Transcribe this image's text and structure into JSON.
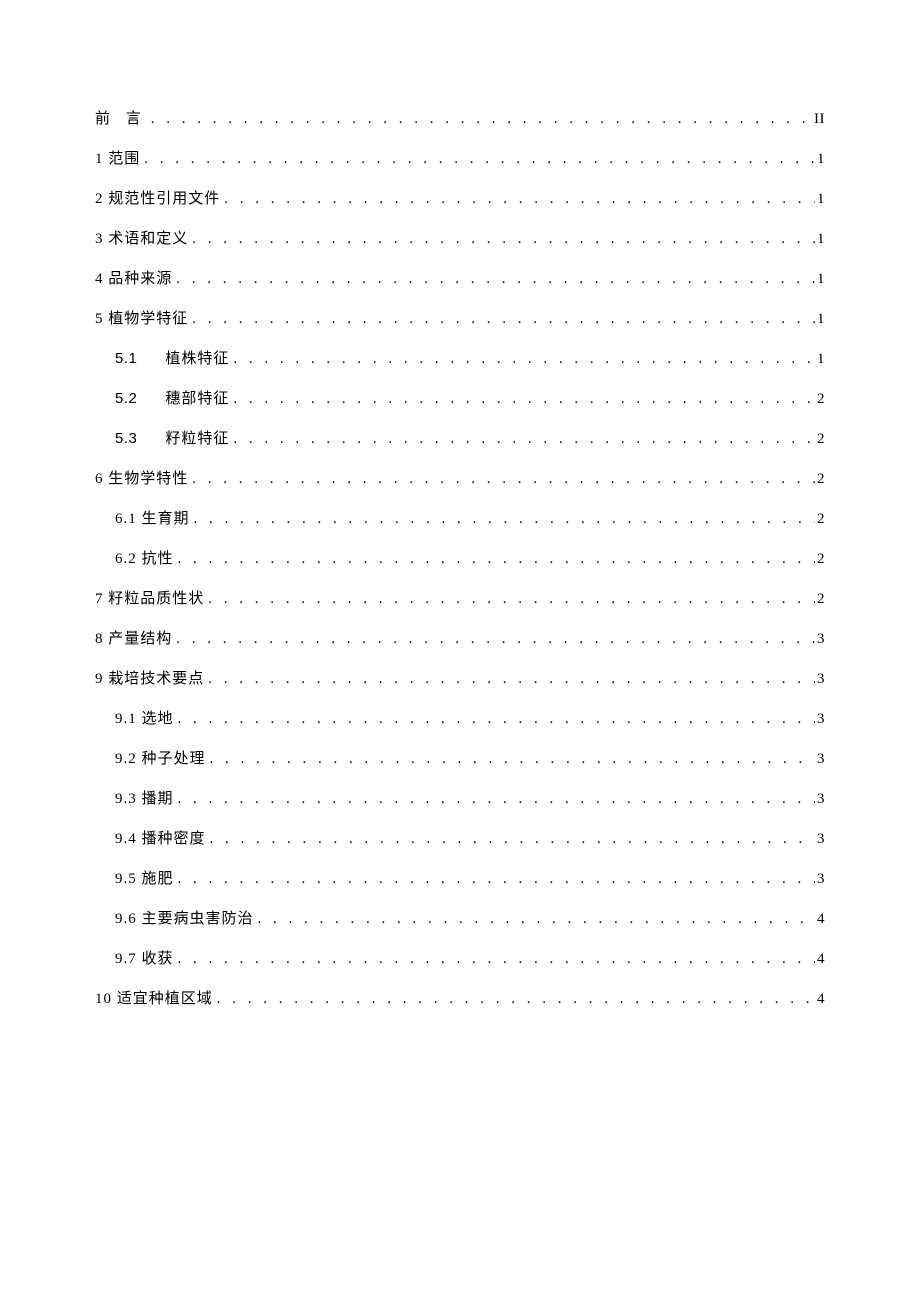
{
  "toc": [
    {
      "level": 0,
      "num": "",
      "label": "前 言",
      "page": "II",
      "preface": true
    },
    {
      "level": 0,
      "num": "",
      "label": "1 范围",
      "page": "1"
    },
    {
      "level": 0,
      "num": "",
      "label": "2 规范性引用文件",
      "page": "1"
    },
    {
      "level": 0,
      "num": "",
      "label": "3 术语和定义",
      "page": "1"
    },
    {
      "level": 0,
      "num": "",
      "label": "4 品种来源",
      "page": "1"
    },
    {
      "level": 0,
      "num": "",
      "label": "5 植物学特征",
      "page": "1"
    },
    {
      "level": 1,
      "num": "5.1",
      "label": "植株特征",
      "page": "1"
    },
    {
      "level": 1,
      "num": "5.2",
      "label": "穗部特征",
      "page": "2"
    },
    {
      "level": 1,
      "num": "5.3",
      "label": "籽粒特征",
      "page": "2"
    },
    {
      "level": 0,
      "num": "",
      "label": "6 生物学特性",
      "page": "2"
    },
    {
      "level": 1,
      "num": "",
      "label": "6.1 生育期",
      "page": "2"
    },
    {
      "level": 1,
      "num": "",
      "label": "6.2 抗性",
      "page": "2"
    },
    {
      "level": 0,
      "num": "",
      "label": "7 籽粒品质性状",
      "page": "2"
    },
    {
      "level": 0,
      "num": "",
      "label": "8 产量结构",
      "page": "3"
    },
    {
      "level": 0,
      "num": "",
      "label": "9 栽培技术要点",
      "page": "3"
    },
    {
      "level": 1,
      "num": "",
      "label": "9.1 选地",
      "page": "3"
    },
    {
      "level": 1,
      "num": "",
      "label": "9.2 种子处理",
      "page": "3"
    },
    {
      "level": 1,
      "num": "",
      "label": "9.3 播期",
      "page": "3"
    },
    {
      "level": 1,
      "num": "",
      "label": "9.4 播种密度",
      "page": "3"
    },
    {
      "level": 1,
      "num": "",
      "label": "9.5 施肥",
      "page": "3"
    },
    {
      "level": 1,
      "num": "",
      "label": "9.6 主要病虫害防治",
      "page": "4"
    },
    {
      "level": 1,
      "num": "",
      "label": "9.7 收获",
      "page": "4"
    },
    {
      "level": 0,
      "num": "",
      "label": "10 适宜种植区域",
      "page": "4"
    }
  ]
}
